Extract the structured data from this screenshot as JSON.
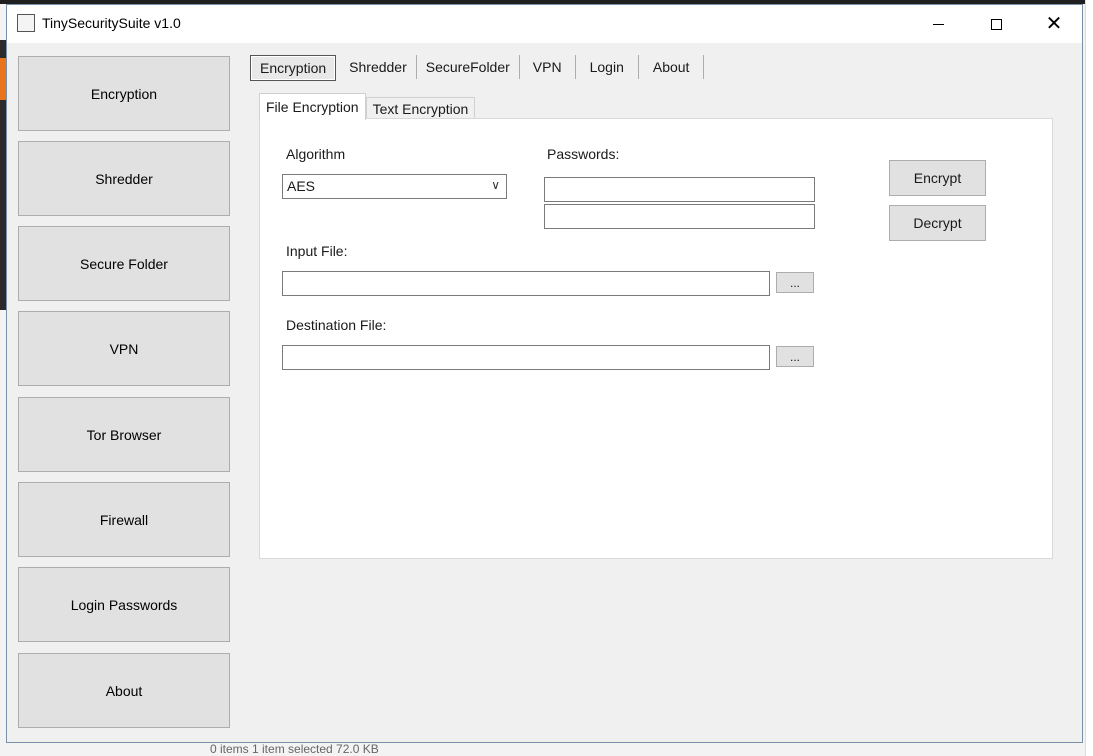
{
  "window": {
    "title": "TinySecuritySuite v1.0"
  },
  "sidebar": {
    "items": [
      {
        "label": "Encryption"
      },
      {
        "label": "Shredder"
      },
      {
        "label": "Secure Folder"
      },
      {
        "label": "VPN"
      },
      {
        "label": "Tor Browser"
      },
      {
        "label": "Firewall"
      },
      {
        "label": "Login Passwords"
      },
      {
        "label": "About"
      }
    ]
  },
  "top_tabs": [
    {
      "label": "Encryption",
      "selected": true
    },
    {
      "label": "Shredder"
    },
    {
      "label": "SecureFolder"
    },
    {
      "label": "VPN"
    },
    {
      "label": "Login"
    },
    {
      "label": "About"
    }
  ],
  "inner_tabs": [
    {
      "label": "File Encryption",
      "selected": true
    },
    {
      "label": "Text Encryption"
    }
  ],
  "form": {
    "algorithm_label": "Algorithm",
    "algorithm_value": "AES",
    "passwords_label": "Passwords:",
    "input_file_label": "Input File:",
    "destination_file_label": "Destination File:",
    "browse_label": "...",
    "encrypt_label": "Encrypt",
    "decrypt_label": "Decrypt"
  },
  "background": {
    "status_text": "0 items    1 item selected  72.0 KB"
  }
}
